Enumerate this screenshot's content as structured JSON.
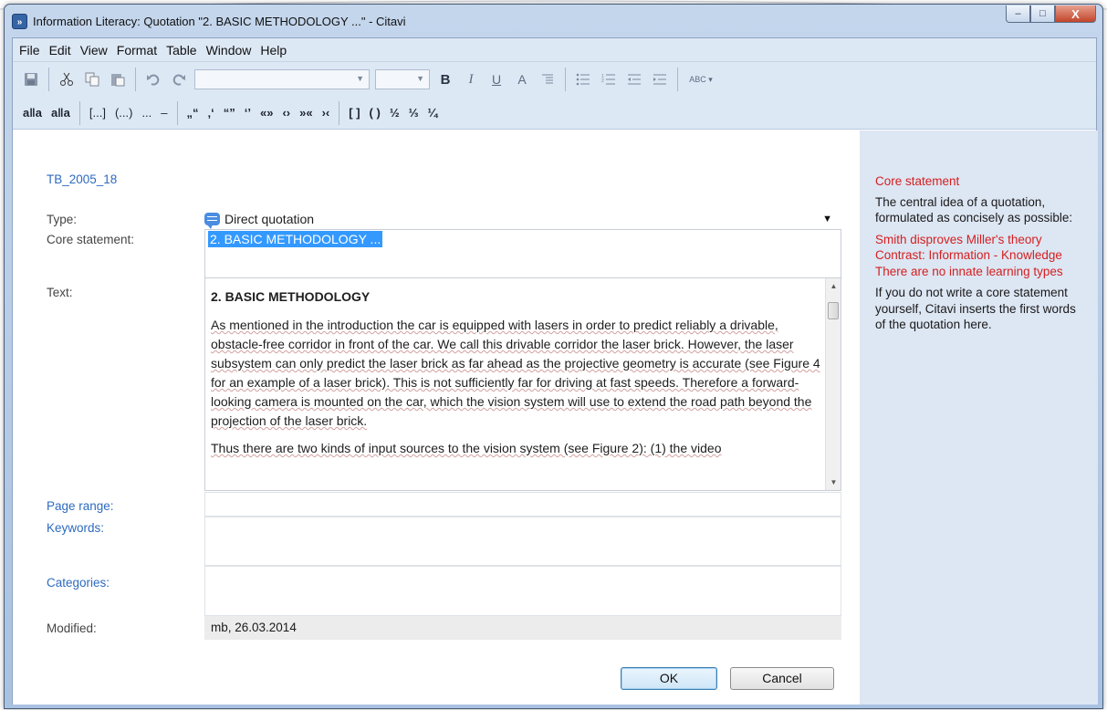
{
  "window": {
    "title": "Information Literacy: Quotation \"2. BASIC METHODOLOGY ...\" - Citavi",
    "app_icon": "»",
    "controls": {
      "minimize": "–",
      "maximize": "□",
      "close": "X"
    }
  },
  "menu": [
    "File",
    "Edit",
    "View",
    "Format",
    "Table",
    "Window",
    "Help"
  ],
  "toolbar": {
    "icons": [
      "save-icon",
      "cut-icon",
      "copy-icon",
      "paste-icon",
      "undo-icon",
      "redo-icon",
      "bold-icon",
      "italic-icon",
      "underline-icon",
      "font-color-icon",
      "paragraph-icon",
      "bullet-list-icon",
      "numbered-list-icon",
      "decrease-indent-icon",
      "increase-indent-icon",
      "spellcheck-icon"
    ],
    "bold": "B",
    "italic": "I",
    "underline": "U",
    "font_color": "A",
    "spellcheck": "ABC"
  },
  "toolbar2": {
    "items": [
      "a‖a",
      "a‖a",
      "[...]",
      "(...)",
      "...",
      "–",
      "„“",
      "‚‘",
      "“”",
      "‘’",
      "«»",
      "‹›",
      "»«",
      "›‹",
      "[ ]",
      "( )",
      "½",
      "⅓",
      "¼"
    ]
  },
  "form": {
    "reference": "TB_2005_18",
    "type_label": "Type:",
    "type_value": "Direct quotation",
    "core_label": "Core statement:",
    "core_value": "2. BASIC METHODOLOGY ...",
    "text_label": "Text:",
    "text_heading": "2. BASIC METHODOLOGY",
    "text_p1": "As mentioned in the introduction the car is equipped with lasers in order to predict reliably a drivable, obstacle-free corridor in front of the car. We call this drivable corridor the laser brick. However, the laser subsystem can only predict the laser brick as far ahead as the projective geometry is accurate (see Figure 4 for an example of a laser brick). This is not sufficiently far for driving at fast speeds. Therefore a forward-looking camera is mounted on the car, which the vision system will use to extend the road path beyond the projection of the laser brick.",
    "text_p2": "Thus there are two kinds of input sources to the vision system (see Figure 2): (1) the video",
    "page_range_label": "Page range:",
    "keywords_label": "Keywords:",
    "categories_label": "Categories:",
    "modified_label": "Modified:",
    "modified_value": "mb, 26.03.2014",
    "ok": "OK",
    "cancel": "Cancel"
  },
  "help": {
    "title": "Core statement",
    "intro": "The central idea of a quotation, formulated as concisely as possible:",
    "examples": [
      "Smith disproves Miller's theory",
      "Contrast: Information - Knowledge",
      "There are no innate learning types"
    ],
    "outro": "If you do not write a core statement yourself, Citavi inserts the first words of the quotation here."
  }
}
